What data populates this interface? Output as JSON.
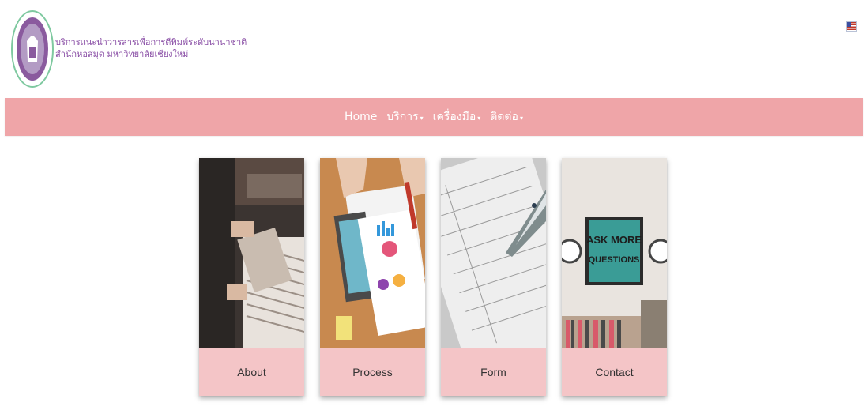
{
  "header": {
    "line1": "บริการแนะนำวารสารเพื่อการตีพิมพ์ระดับนานาชาติ",
    "line2": "สำนักหอสมุด มหาวิทยาลัยเชียงใหม่"
  },
  "nav": {
    "items": [
      {
        "label": "Home",
        "has_dropdown": false
      },
      {
        "label": "บริการ",
        "has_dropdown": true
      },
      {
        "label": "เครื่องมือ",
        "has_dropdown": true
      },
      {
        "label": "ติดต่อ",
        "has_dropdown": true
      }
    ],
    "caret": "▾"
  },
  "cards": [
    {
      "label": "About",
      "image": "records-browsing-photo"
    },
    {
      "label": "Process",
      "image": "documents-charts-photo"
    },
    {
      "label": "Form",
      "image": "form-pen-photo"
    },
    {
      "label": "Contact",
      "image": "ask-more-questions-photo"
    }
  ],
  "poster": {
    "line1": "ASK MORE",
    "line2": "QUESTIONS"
  },
  "colors": {
    "navbar": "#efa5a8",
    "card_label_bg": "#f4c5c7",
    "brand_text": "#8a4fa6"
  }
}
